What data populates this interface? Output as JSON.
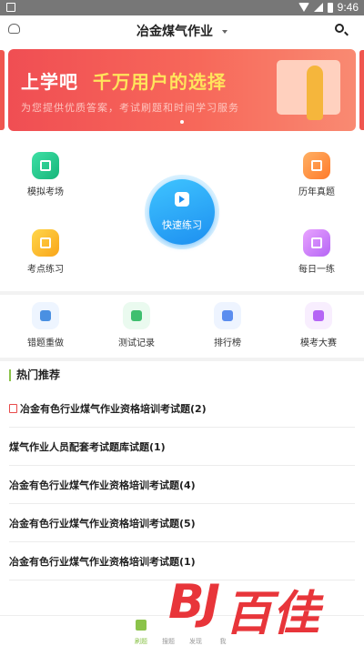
{
  "status": {
    "time": "9:46"
  },
  "header": {
    "title": "冶金煤气作业"
  },
  "banner": {
    "headline_a": "上学吧",
    "headline_b": "千万用户的选择",
    "subtext": "为您提供优质答案，考试刷题和时间学习服务"
  },
  "functions": {
    "mock_exam": "模拟考场",
    "past_exams": "历年真题",
    "quick_practice": "快速练习",
    "point_practice": "考点练习",
    "daily": "每日一练"
  },
  "tools": {
    "wrong_redo": "错题重做",
    "test_record": "测试记录",
    "ranking": "排行榜",
    "mock_contest": "模考大赛"
  },
  "hot": {
    "title": "热门推荐",
    "items": [
      "冶金有色行业煤气作业资格培训考试题(2)",
      "煤气作业人员配套考试题库试题(1)",
      "冶金有色行业煤气作业资格培训考试题(4)",
      "冶金有色行业煤气作业资格培训考试题(5)",
      "冶金有色行业煤气作业资格培训考试题(1)"
    ]
  },
  "tabbar": {
    "tab1": "刷题",
    "tab2": "搜题",
    "tab3": "发现",
    "tab4": "我"
  },
  "watermark": {
    "logo": "BJ",
    "text": "百佳"
  },
  "colors": {
    "accent": "#8bc34a",
    "quick": "#1d8ff0",
    "banner": "#f04e53"
  }
}
